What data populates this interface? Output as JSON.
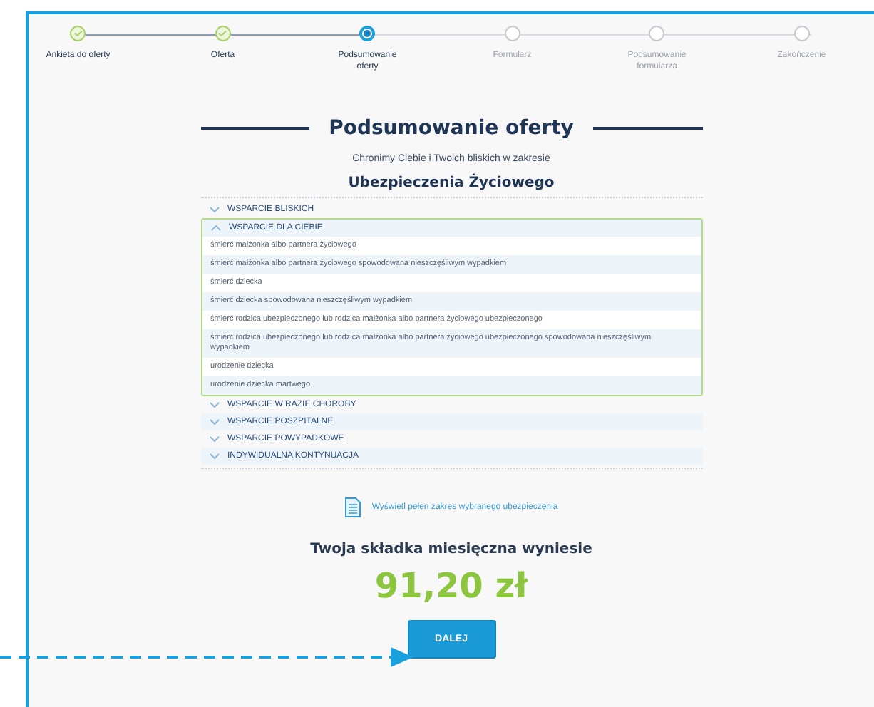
{
  "steps": [
    {
      "label": "Ankieta do oferty",
      "completed": true,
      "selected": false
    },
    {
      "label": "Oferta",
      "completed": true,
      "selected": false
    },
    {
      "label": "Podsumowanie oferty",
      "completed": false,
      "selected": true
    },
    {
      "label": "Formularz",
      "completed": false,
      "selected": false
    },
    {
      "label": "Podsumowanie formularza",
      "completed": false,
      "selected": false
    },
    {
      "label": "Zakończenie",
      "completed": false,
      "selected": false
    }
  ],
  "summary": {
    "title": "Podsumowanie oferty",
    "subtitle": "Chronimy Ciebie i Twoich bliskich w zakresie",
    "product": "Ubezpieczenia Życiowego"
  },
  "sections": [
    {
      "title": "WSPARCIE BLISKICH",
      "expanded": false
    },
    {
      "title": "WSPARCIE DLA CIEBIE",
      "expanded": true,
      "items": [
        "śmierć małżonka albo partnera życiowego",
        "śmierć małżonka albo partnera życiowego spowodowana nieszczęśliwym wypadkiem",
        "śmierć dziecka",
        "śmierć dziecka spowodowana nieszczęśliwym wypadkiem",
        "śmierć rodzica ubezpieczonego lub rodzica małżonka albo partnera życiowego ubezpieczonego",
        "śmierć rodzica ubezpieczonego lub rodzica małżonka albo partnera życiowego ubezpieczonego spowodowana nieszczęśliwym wypadkiem",
        "urodzenie dziecka",
        "urodzenie dziecka martwego"
      ]
    },
    {
      "title": "WSPARCIE W RAZIE CHOROBY",
      "expanded": false
    },
    {
      "title": "WSPARCIE POSZPITALNE",
      "expanded": false
    },
    {
      "title": "WSPARCIE POWYPADKOWE",
      "expanded": false
    },
    {
      "title": "INDYWIDUALNA KONTYNUACJA",
      "expanded": false
    }
  ],
  "link": "Wyświetl pełen zakres wybranego ubezpieczenia",
  "premium": {
    "label": "Twoja składka miesięczna wyniesie",
    "amount": "91,20 zł"
  },
  "button": "DALEJ"
}
